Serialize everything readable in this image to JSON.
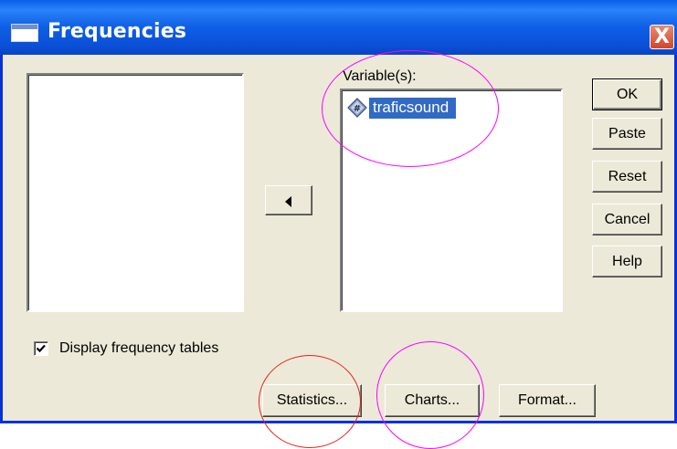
{
  "window": {
    "title": "Frequencies",
    "close_glyph": "X"
  },
  "variables": {
    "label": "Variable(s):",
    "items": [
      {
        "name": "traficsound",
        "icon": "numeric-variable-icon"
      }
    ]
  },
  "buttons": {
    "ok": "OK",
    "paste": "Paste",
    "reset": "Reset",
    "cancel": "Cancel",
    "help": "Help",
    "statistics": "Statistics...",
    "charts": "Charts...",
    "format": "Format..."
  },
  "options": {
    "display_frequency_tables": {
      "label": "Display frequency tables",
      "checked": true
    }
  },
  "annotations": {
    "circle_colors": [
      "#ff00ff",
      "#e8231e",
      "#ff00ff"
    ]
  }
}
